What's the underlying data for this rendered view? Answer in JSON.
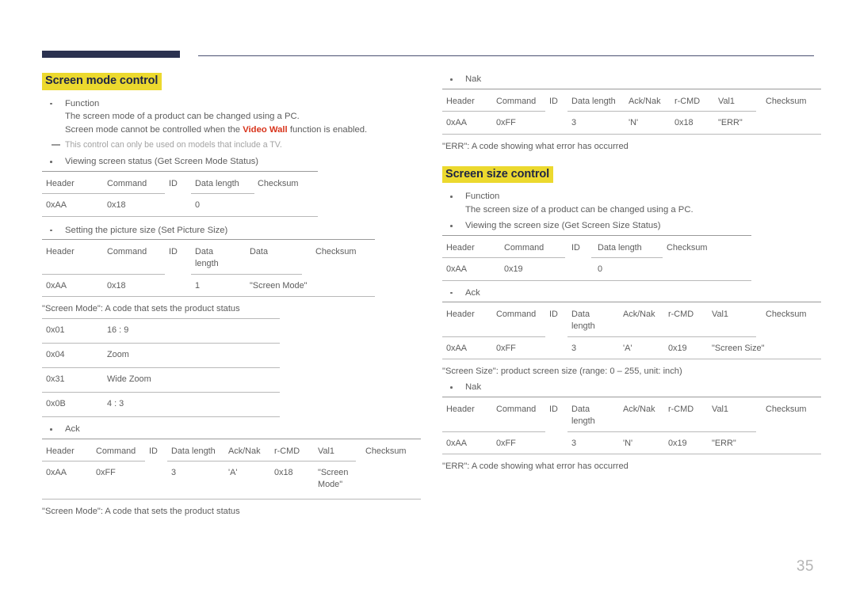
{
  "page": {
    "number": "35"
  },
  "left": {
    "heading": "Screen mode control",
    "function_label": "Function",
    "function_line1": "The screen mode of a product can be changed using a PC.",
    "function_line2_pre": "Screen mode cannot be controlled when the ",
    "function_line2_em": "Video Wall",
    "function_line2_post": " function is enabled.",
    "note": "This control can only be used on models that include a TV.",
    "get_status_label": "Viewing screen status (Get Screen Mode Status)",
    "get_status_table": {
      "headers": [
        "Header",
        "Command",
        "ID",
        "Data length",
        "Checksum"
      ],
      "row": [
        "0xAA",
        "0x18",
        "",
        "0",
        ""
      ]
    },
    "set_size_label": "Setting the picture size (Set Picture Size)",
    "set_size_table": {
      "headers": [
        "Header",
        "Command",
        "ID",
        "Data\nlength",
        "Data",
        "Checksum"
      ],
      "row": [
        "0xAA",
        "0x18",
        "",
        "1",
        "\"Screen Mode\"",
        ""
      ]
    },
    "screen_mode_caption": "\"Screen Mode\": A code that sets the product status",
    "screen_mode_codes": [
      {
        "code": "0x01",
        "value": "16 : 9"
      },
      {
        "code": "0x04",
        "value": "Zoom"
      },
      {
        "code": "0x31",
        "value": "Wide Zoom"
      },
      {
        "code": "0x0B",
        "value": "4 : 3"
      }
    ],
    "ack_label": "Ack",
    "ack_table": {
      "headers": [
        "Header",
        "Command",
        "ID",
        "Data length",
        "Ack/Nak",
        "r-CMD",
        "Val1",
        "Checksum"
      ],
      "row": [
        "0xAA",
        "0xFF",
        "",
        "3",
        "'A'",
        "0x18",
        "\"Screen\nMode\"",
        ""
      ]
    },
    "ack_caption": "\"Screen Mode\": A code that sets the product status"
  },
  "right": {
    "nak_label_top": "Nak",
    "nak_table_top": {
      "headers": [
        "Header",
        "Command",
        "ID",
        "Data length",
        "Ack/Nak",
        "r-CMD",
        "Val1",
        "Checksum"
      ],
      "row": [
        "0xAA",
        "0xFF",
        "",
        "3",
        "'N'",
        "0x18",
        "\"ERR\"",
        ""
      ]
    },
    "err_caption_top": "\"ERR\": A code showing what error has occurred",
    "heading": "Screen size control",
    "function_label": "Function",
    "function_line1": "The screen size of a product can be changed using a PC.",
    "get_status_label": "Viewing the screen size (Get Screen Size Status)",
    "get_status_table": {
      "headers": [
        "Header",
        "Command",
        "ID",
        "Data length",
        "Checksum"
      ],
      "row": [
        "0xAA",
        "0x19",
        "",
        "0",
        ""
      ]
    },
    "ack_label": "Ack",
    "ack_table": {
      "headers": [
        "Header",
        "Command",
        "ID",
        "Data\nlength",
        "Ack/Nak",
        "r-CMD",
        "Val1",
        "Checksum"
      ],
      "row": [
        "0xAA",
        "0xFF",
        "",
        "3",
        "'A'",
        "0x19",
        "\"Screen Size\"",
        ""
      ]
    },
    "screen_size_caption": "\"Screen Size\": product screen size (range: 0 – 255, unit: inch)",
    "nak_label_bottom": "Nak",
    "nak_table_bottom": {
      "headers": [
        "Header",
        "Command",
        "ID",
        "Data\nlength",
        "Ack/Nak",
        "r-CMD",
        "Val1",
        "Checksum"
      ],
      "row": [
        "0xAA",
        "0xFF",
        "",
        "3",
        "'N'",
        "0x19",
        "\"ERR\"",
        ""
      ]
    },
    "err_caption_bottom": "\"ERR\": A code showing what error has occurred"
  }
}
